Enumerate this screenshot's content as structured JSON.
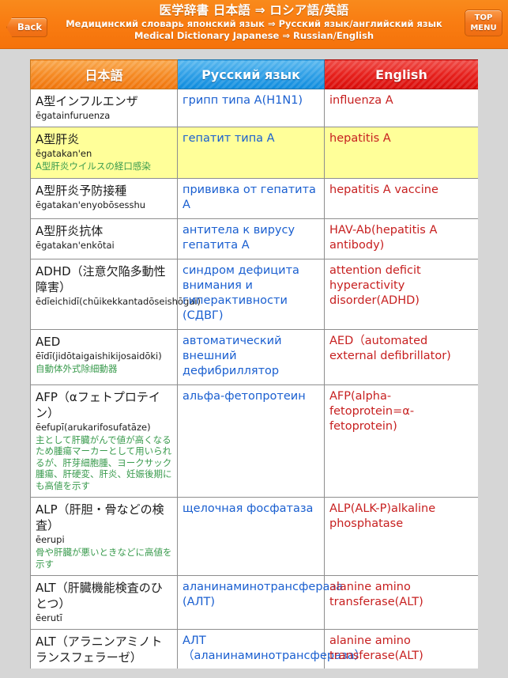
{
  "header": {
    "title_ja": "医学辞書 日本語 ⇒ ロシア語/英語",
    "title_ru": "Медицинский словарь японский язык ⇒ Русский язык/английский язык",
    "title_en": "Medical Dictionary Japanese ⇒ Russian/English",
    "back_label": "Back",
    "top_menu_line1": "TOP",
    "top_menu_line2": "MENU",
    "accent_orange": "#f5720a",
    "accent_blue": "#0d8bdd",
    "accent_red": "#d80b08"
  },
  "table": {
    "columns": [
      {
        "label": "日本語"
      },
      {
        "label": "Русский язык"
      },
      {
        "label": "English"
      }
    ],
    "rows": [
      {
        "highlighted": false,
        "ja": "A型インフルエンザ",
        "romaji": "ēgatainfuruenza",
        "note": "",
        "ru": "грипп типа A(H1N1)",
        "en": "influenza A"
      },
      {
        "highlighted": true,
        "ja": "A型肝炎",
        "romaji": "ēgatakan'en",
        "note": "A型肝炎ウイルスの経口感染",
        "ru": "гепатит типа A",
        "en": "hepatitis A"
      },
      {
        "highlighted": false,
        "ja": "A型肝炎予防接種",
        "romaji": "ēgatakan'enyobōsesshu",
        "note": "",
        "ru": "прививка от гепатита A",
        "en": "hepatitis A vaccine"
      },
      {
        "highlighted": false,
        "ja": "A型肝炎抗体",
        "romaji": "ēgatakan'enkōtai",
        "note": "",
        "ru": "антитела к вирусу гепатита A",
        "en": "HAV-Ab(hepatitis A antibody)"
      },
      {
        "highlighted": false,
        "ja": "ADHD（注意欠陥多動性障害）",
        "romaji": "ēdīeichidī(chūikekkantadōseishōgai)",
        "note": "",
        "ru": "синдром дефицита внимания и гиперактивности (СДВГ)",
        "en": "attention deficit hyperactivity disorder(ADHD)"
      },
      {
        "highlighted": false,
        "ja": "AED",
        "romaji": "ēīdī(jidōtaigaishikijosaidōki)",
        "note": "自動体外式除細動器",
        "ru": "автоматический внешний дефибриллятор",
        "en": "AED（automated external defibrillator)"
      },
      {
        "highlighted": false,
        "ja": "AFP（αフェトプロテイン）",
        "romaji": "ēefupī(arukarifosufatāze)",
        "note": "主として肝臓がんで値が高くなるため腫瘍マーカーとして用いられるが、肝芽細胞腫、ヨークサック腫瘍、肝硬変、肝炎、妊娠後期にも高値を示す",
        "ru": "альфа-фетопротеин",
        "en": "AFP(alpha-fetoprotein=α-fetoprotein)"
      },
      {
        "highlighted": false,
        "ja": "ALP（肝胆・骨などの検査）",
        "romaji": "ēerupi",
        "note": "骨や肝臓が悪いときなどに高値を示す",
        "ru": "щелочная фосфатаза",
        "en": "ALP(ALK-P)alkaline phosphatase"
      },
      {
        "highlighted": false,
        "ja": "ALT（肝臓機能検査のひとつ）",
        "romaji": "ēerutī",
        "note": "",
        "ru": "аланинаминотрансфераза (АЛТ)",
        "en": "alanine amino transferase(ALT)"
      },
      {
        "highlighted": false,
        "ja": "ALT（アラニンアミノトランスフェラーゼ）",
        "romaji": "",
        "note": "",
        "ru": "АЛТ（аланинаминотрансфераза）",
        "en": "alanine amino transferase(ALT)"
      }
    ]
  }
}
